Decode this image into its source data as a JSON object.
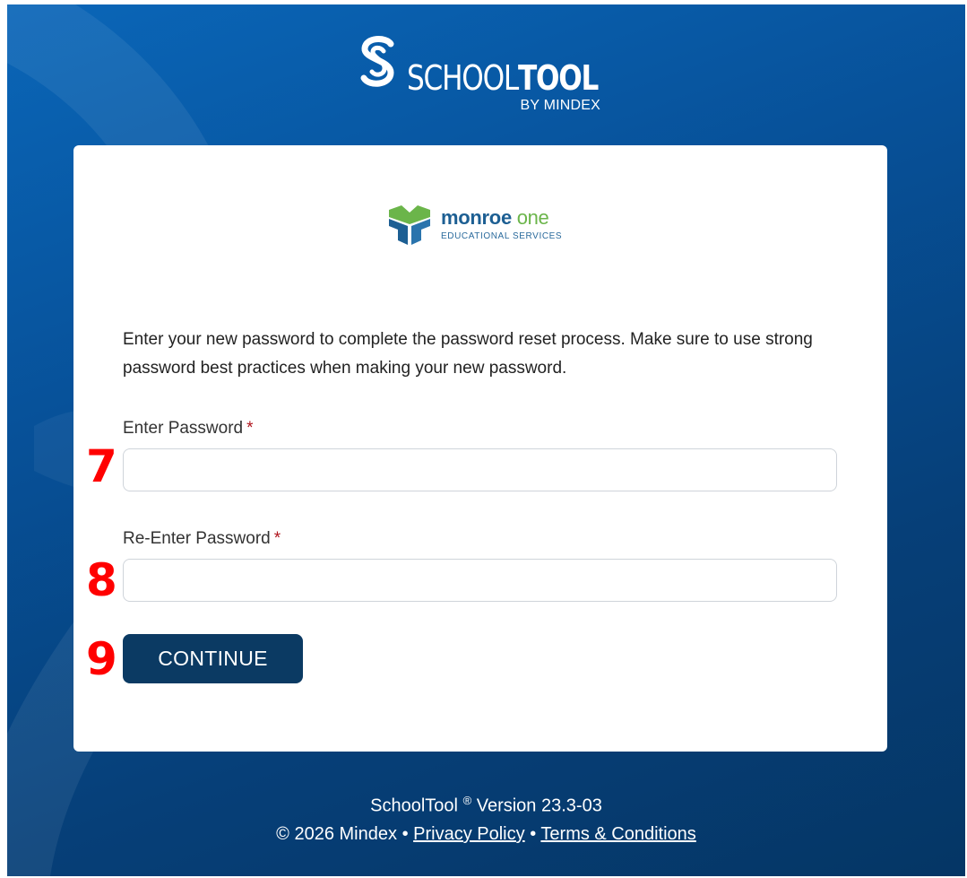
{
  "brand": {
    "name_part1": "SCHOOL",
    "name_part2": "TOOL",
    "byline": "BY MINDEX",
    "logo_icon": "schooltool-s-icon"
  },
  "partner": {
    "name_part1": "monroe",
    "name_part2": "one",
    "subtitle": "EDUCATIONAL SERVICES",
    "logo_icon": "monroe-one-cube-icon"
  },
  "form": {
    "instructions": "Enter your new password to complete the password reset process. Make sure to use strong password best practices when making your new password.",
    "password_label": "Enter Password",
    "password_value": "",
    "confirm_label": "Re-Enter Password",
    "confirm_value": "",
    "required_mark": "*",
    "continue_label": "CONTINUE"
  },
  "markers": {
    "password": "7",
    "confirm": "8",
    "continue": "9"
  },
  "footer": {
    "product": "SchoolTool",
    "registered": "®",
    "version_text": "Version 23.3-03",
    "copyright": "© 2026 Mindex",
    "separator": "•",
    "privacy_link": "Privacy Policy",
    "terms_link": "Terms & Conditions"
  },
  "colors": {
    "background": "#075199",
    "button": "#0b3a63",
    "required": "#b0161e",
    "marker": "#ff0000"
  }
}
